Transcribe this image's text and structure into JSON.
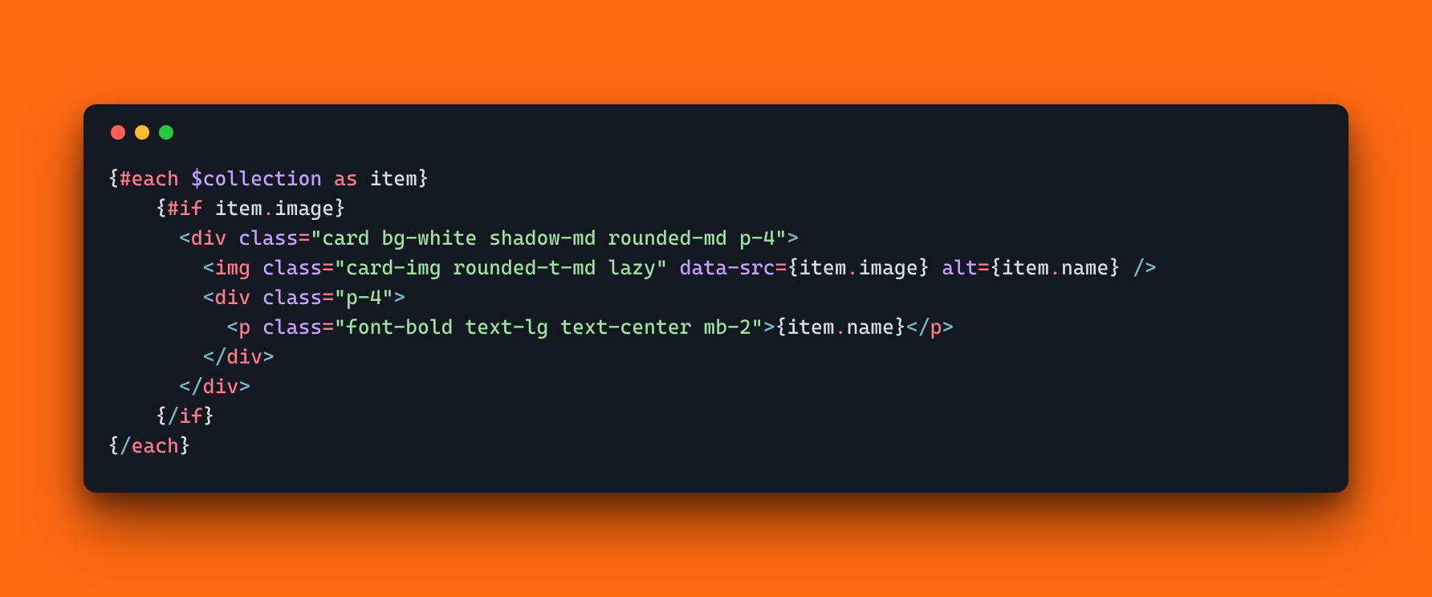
{
  "window": {
    "traffic_lights": {
      "red": "close",
      "yellow": "minimize",
      "green": "zoom"
    }
  },
  "code": {
    "line1": {
      "brace_open": "{",
      "hash_key": "#each",
      "sp1": " ",
      "var": "$collection",
      "sp2": " ",
      "as": "as",
      "sp3": " ",
      "ident": "item",
      "brace_close": "}"
    },
    "line2": {
      "indent": "    ",
      "brace_open": "{",
      "hash_key": "#if",
      "sp": " ",
      "obj": "item",
      "dot": ".",
      "prop": "image",
      "brace_close": "}"
    },
    "line3": {
      "indent": "      ",
      "lt": "<",
      "tag": "div",
      "sp": " ",
      "attr": "class",
      "eq": "=",
      "str": "\"card bg-white shadow-md rounded-md p-4\"",
      "gt": ">"
    },
    "line4": {
      "indent": "        ",
      "lt": "<",
      "tag": "img",
      "sp1": " ",
      "attr1": "class",
      "eq1": "=",
      "str1": "\"card-img rounded-t-md lazy\"",
      "sp2": " ",
      "attr2": "data-src",
      "eq2": "=",
      "exA_open": "{",
      "exA_obj": "item",
      "exA_dot": ".",
      "exA_prop": "image",
      "exA_close": "}",
      "sp3": " ",
      "attr3": "alt",
      "eq3": "=",
      "exB_open": "{",
      "exB_obj": "item",
      "exB_dot": ".",
      "exB_prop": "name",
      "exB_close": "}",
      "sp4": " ",
      "selfclose": "/>"
    },
    "line5": {
      "indent": "        ",
      "lt": "<",
      "tag": "div",
      "sp": " ",
      "attr": "class",
      "eq": "=",
      "str": "\"p-4\"",
      "gt": ">"
    },
    "line6": {
      "indent": "          ",
      "lt": "<",
      "tag": "p",
      "sp": " ",
      "attr": "class",
      "eq": "=",
      "str": "\"font-bold text-lg text-center mb-2\"",
      "gt": ">",
      "ex_open": "{",
      "ex_obj": "item",
      "ex_dot": ".",
      "ex_prop": "name",
      "ex_close": "}",
      "lt2": "</",
      "tag2": "p",
      "gt2": ">"
    },
    "line7": {
      "indent": "        ",
      "lt": "</",
      "tag": "div",
      "gt": ">"
    },
    "line8": {
      "indent": "      ",
      "lt": "</",
      "tag": "div",
      "gt": ">"
    },
    "line9": {
      "indent": "    ",
      "brace_open": "{",
      "slash": "/",
      "key": "if",
      "brace_close": "}"
    },
    "line10": {
      "brace_open": "{",
      "slash": "/",
      "key": "each",
      "brace_close": "}"
    }
  }
}
